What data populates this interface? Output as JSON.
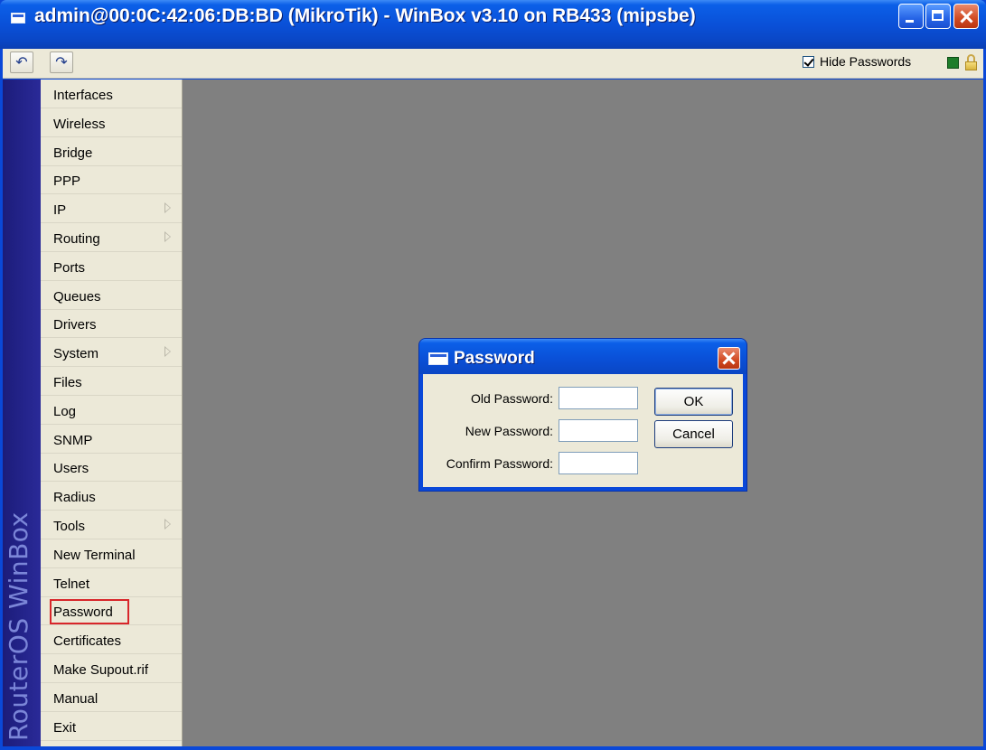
{
  "window": {
    "title": "admin@00:0C:42:06:DB:BD (MikroTik) - WinBox v3.10 on RB433 (mipsbe)"
  },
  "toolbar": {
    "undo_icon": "undo-icon",
    "redo_icon": "redo-icon",
    "hide_passwords_label": "Hide Passwords",
    "hide_passwords_checked": true,
    "status_color": "#1e7d2a"
  },
  "brand": {
    "text": "RouterOS WinBox"
  },
  "menu": {
    "items": [
      {
        "label": "Interfaces",
        "submenu": false
      },
      {
        "label": "Wireless",
        "submenu": false
      },
      {
        "label": "Bridge",
        "submenu": false
      },
      {
        "label": "PPP",
        "submenu": false
      },
      {
        "label": "IP",
        "submenu": true
      },
      {
        "label": "Routing",
        "submenu": true
      },
      {
        "label": "Ports",
        "submenu": false
      },
      {
        "label": "Queues",
        "submenu": false
      },
      {
        "label": "Drivers",
        "submenu": false
      },
      {
        "label": "System",
        "submenu": true
      },
      {
        "label": "Files",
        "submenu": false
      },
      {
        "label": "Log",
        "submenu": false
      },
      {
        "label": "SNMP",
        "submenu": false
      },
      {
        "label": "Users",
        "submenu": false
      },
      {
        "label": "Radius",
        "submenu": false
      },
      {
        "label": "Tools",
        "submenu": true
      },
      {
        "label": "New Terminal",
        "submenu": false
      },
      {
        "label": "Telnet",
        "submenu": false
      },
      {
        "label": "Password",
        "submenu": false,
        "highlighted": true
      },
      {
        "label": "Certificates",
        "submenu": false
      },
      {
        "label": "Make Supout.rif",
        "submenu": false
      },
      {
        "label": "Manual",
        "submenu": false
      },
      {
        "label": "Exit",
        "submenu": false
      }
    ]
  },
  "dialog": {
    "title": "Password",
    "fields": [
      {
        "label": "Old Password:",
        "value": ""
      },
      {
        "label": "New Password:",
        "value": ""
      },
      {
        "label": "Confirm Password:",
        "value": ""
      }
    ],
    "ok_label": "OK",
    "cancel_label": "Cancel"
  }
}
